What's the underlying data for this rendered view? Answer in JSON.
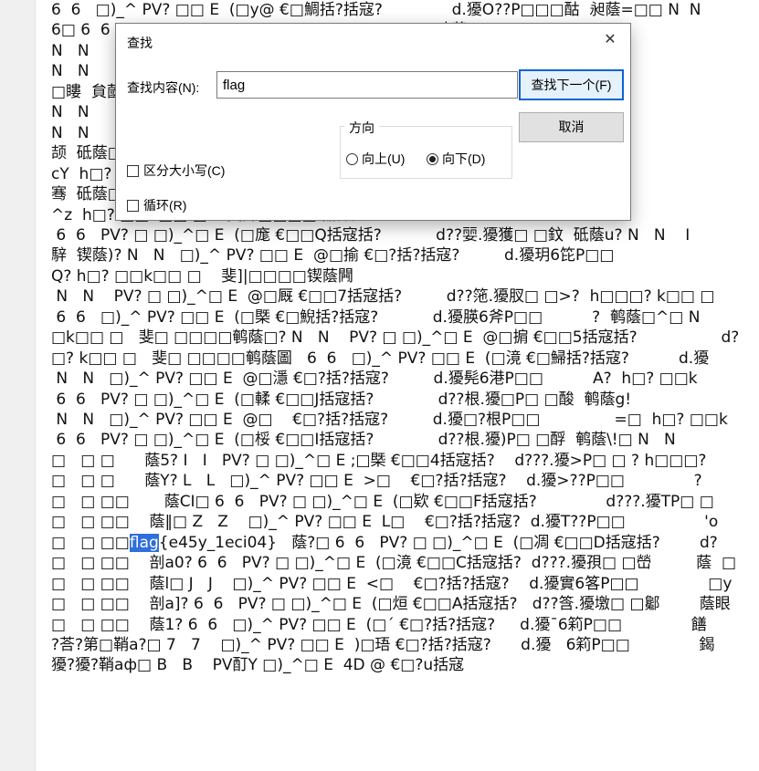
{
  "editor": {
    "lines": [
      "6  6   □)_^ PV? □□ E  (□y@ €□鯛括?括寇?              d.獶O??P□□□酤  昶蔭=□□ N  N",
      "6□ 6  6                                                                  吨蔭□? N   N    □",
      "N   N                                                                      h□? ? k□□ □   斐",
      "N   N                                                                      h□? ? k□□ □   斐",
      "□瞜  貟蔮",
      "N   N                                                                      h□? ? k□□ □",
      "N   N                                                                     □? ? k□□ □   斐",
      "颉  砥蔭□",
      "cY  h□?                                                                  P□□",
      "骞  砥蔭□                                                               □S括寇括? d?",
      "^z  h□? □□k□□ □    斐諢□□□□砥蔭喔",
      " 6  6   PV? □ □)_^□ E  (□庬 €□□Q括寇括?           d??婯.獶獲□ □鈫  砥蔭u? N   N    I",
      "騂  锲蔭)? N   N   □)_^ PV? □□ E  @□揄 €□?括?括寇?         d.獶玥6笓P□□",
      "Q? h□? □□k□□ □    斐]|□□□□锲蔭闁",
      " N   N    PV? □ □)_^□ E  @□厩 €□□7括寇括?         d??筂.獶肞□ □>?  h□□□? k□□ □",
      " 6  6   □)_^ PV? □□ E  (□槩 €□鯢括?括寇?           d.獶朠6斧P□□          ?  鹌蔭□^□ N",
      "□k□□ □   斐□ □□□□鹌蔭□? N   N    PV? □ □)_^□ E  @□掮 €□□5括寇括?                 d?",
      "□? k□□ □   斐□ □□□□鹌蔭圖   6  6   □)_^ PV? □□ E  (□滰 €□鯞括?括寇?          d.獶",
      " N   N   □)_^ PV? □□ E  @□濦 €□?括?括寇?         d.獶髡6港P□□          A?  h□? □□k",
      " 6  6   PV? □ □)_^□ E  (□輮 €□□J括寇括?             d??根.獶□P□ □酸  鹌蔭g!",
      " N   N   □)_^ PV? □□ E  @□    €□?括?括寇?         d.獶□?根P□□               =□  h□? □□k",
      " 6  6   PV? □ □)_^□ E  (□桵 €□□I括寇括?             d??根.獶)P□ □酻  鹌蔭\\!□ N   N",
      "□   □ □      蔭5? I   I   PV? □ □)_^□ E ;□槩 €□□4括寇括?    d???.獶>P□ □ ? h□□□?",
      "□   □ □      蔭Y? L   L   □)_^ PV? □□ E  >□    €□?括?括寇?    d.獶>??P□□              ?",
      "□   □ □□       蔭CI□ 6  6   PV? □ □)_^□ E  (□欵 €□□F括寇括?              d???.獶TP□ □",
      "□   □ □□    蔭‖□ Z   Z    □)_^ PV? □□ E  L□    €□?括?括寇?  d.獶T??P□□                'o",
      "□   □ □□",
      "□   □ □□    剖a0? 6  6   PV? □ □)_^□ E  (□滰 €□□C括寇括?  d???.獶孭□ □嵤         蔭  □",
      "□   □ □□    蔭l□ J   J    □)_^ PV? □□ E  <□    €□?括?括寇?    d.獶實6笿P□□              □y",
      "□   □ □□    剖a]? 6  6   PV? □ □)_^□ E  (□烜 €□□A括寇括?   d??筨.獶墽□ □酁        蔭眼",
      "□   □ □□    蔭1? 6  6   □)_^ PV? □□ E  (□´ €□?括?括寇?     d.獶ˉ6筣P□□              饍",
      "?荅?第□鞘a?□ 7   7    □)_^ PV? □□ E  )□珸 €□?括?括寇?      d.獶   6筣P□□              鍻",
      "獶?獶?鞘aф□ B   B    PV酊Y □)_^□ E  4D @ €□?u括寇"
    ],
    "hl_line_prefix": "□   □ □□",
    "hl_word": "flag",
    "hl_line_suffix": "{e45y_1eci04}   蔭?□ 6  6   PV? □ □)_^□ E  (□凋 €□□D括寇括?        d?"
  },
  "find_dialog": {
    "title": "查找",
    "close_glyph": "✕",
    "find_label": "查找内容(N):",
    "find_value": "flag",
    "find_next_label": "查找下一个(F)",
    "cancel_label": "取消",
    "direction_label": "方向",
    "up_label": "向上(U)",
    "down_label": "向下(D)",
    "match_case_label": "区分大小写(C)",
    "wrap_label": "循环(R)",
    "direction_selected": "down"
  }
}
